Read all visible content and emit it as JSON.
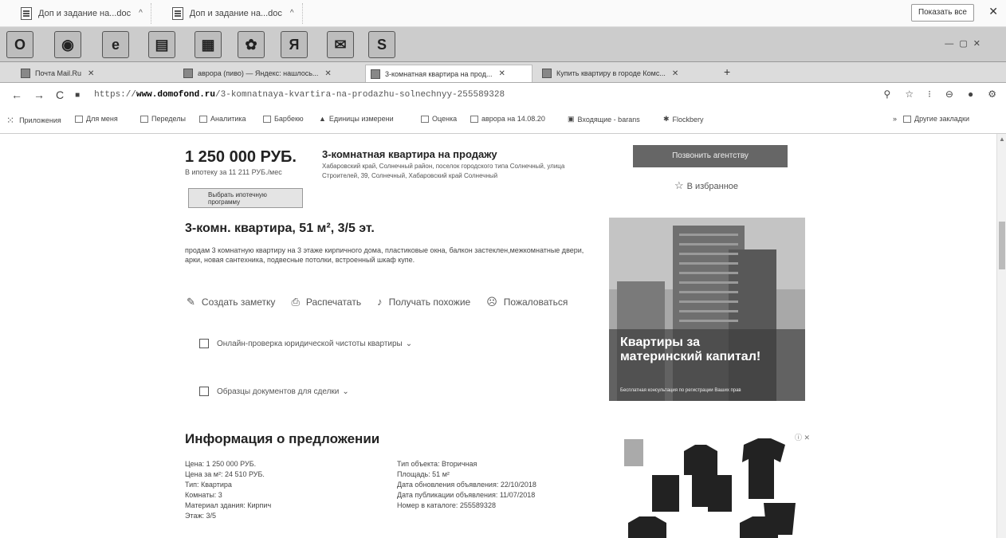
{
  "downloads": {
    "items": [
      {
        "label": "Доп и задание на...doc"
      },
      {
        "label": "Доп и задание на...doc"
      }
    ],
    "show_all": "Показать все"
  },
  "taskbar": {
    "apps": [
      "opera",
      "chrome",
      "ie",
      "files",
      "document",
      "settings",
      "yandex",
      "mail",
      "skype"
    ]
  },
  "tabs": [
    {
      "title": "Почта Mail.Ru"
    },
    {
      "title": "аврора (пиво) — Яндекс: нашлось..."
    },
    {
      "title": "3-комнатная квартира на прод..."
    },
    {
      "title": "Купить квартиру в городе Комс..."
    }
  ],
  "address_bar": {
    "scheme": "https://",
    "host": "www.domofond.ru",
    "path": "/3-komnatnaya-kvartira-na-prodazhu-solnechnyy-255589328"
  },
  "bookmarks": [
    {
      "label": "Приложения"
    },
    {
      "label": "Для меня"
    },
    {
      "label": "Переделы"
    },
    {
      "label": "Аналитика"
    },
    {
      "label": "Барбекю"
    },
    {
      "label": "Единицы измерени"
    },
    {
      "label": "Оценка"
    },
    {
      "label": "аврора на 14.08.20"
    },
    {
      "label": "Входящие - barans"
    },
    {
      "label": "Flockbery"
    },
    {
      "label": "Другие закладки"
    }
  ],
  "listing": {
    "price": "1 250 000 РУБ.",
    "mortgage": "В ипотеку за 11 211 РУБ./мес",
    "program_button": "Выбрать ипотечную программу",
    "title": "3-комнатная квартира на продажу",
    "address": "Хабаровский край, Солнечный район, поселок городского типа Солнечный, улица Строителей, 39, Солнечный, Хабаровский край Солнечный",
    "contact_button": "Позвонить агентству",
    "favorite": "В избранное",
    "heading": "3-комн. квартира, 51 м², 3/5 эт.",
    "description": "продам 3 комнатную квартиру на 3 этаже кирпичного дома, пластиковые окна, балкон застеклен,межкомнатные двери, арки, новая сантехника, подвесные потолки, встроенный шкаф купе.",
    "actions": [
      {
        "label": "Создать заметку"
      },
      {
        "label": "Распечатать"
      },
      {
        "label": "Получать похожие"
      },
      {
        "label": "Пожаловаться"
      }
    ],
    "check_legal": "Онлайн-проверка юридической чистоты квартиры",
    "check_docs": "Образцы документов для сделки"
  },
  "ad": {
    "title": "Квартиры за материнский капитал!",
    "subtitle": "Бесплатная консультация по регистрации Ваших прав"
  },
  "info": {
    "title": "Информация о предложении",
    "left": [
      "Цена: 1 250 000 РУБ.",
      "Цена за м²: 24 510 РУБ.",
      "Тип: Квартира",
      "Комнаты: 3",
      "Материал здания: Кирпич",
      "Этаж: 3/5"
    ],
    "right": [
      "Тип объекта: Вторичная",
      "Площадь: 51 м²",
      "Дата обновления объявления: 22/10/2018",
      "Дата публикации объявления: 11/07/2018",
      "Номер в каталоге: 255589328"
    ]
  }
}
